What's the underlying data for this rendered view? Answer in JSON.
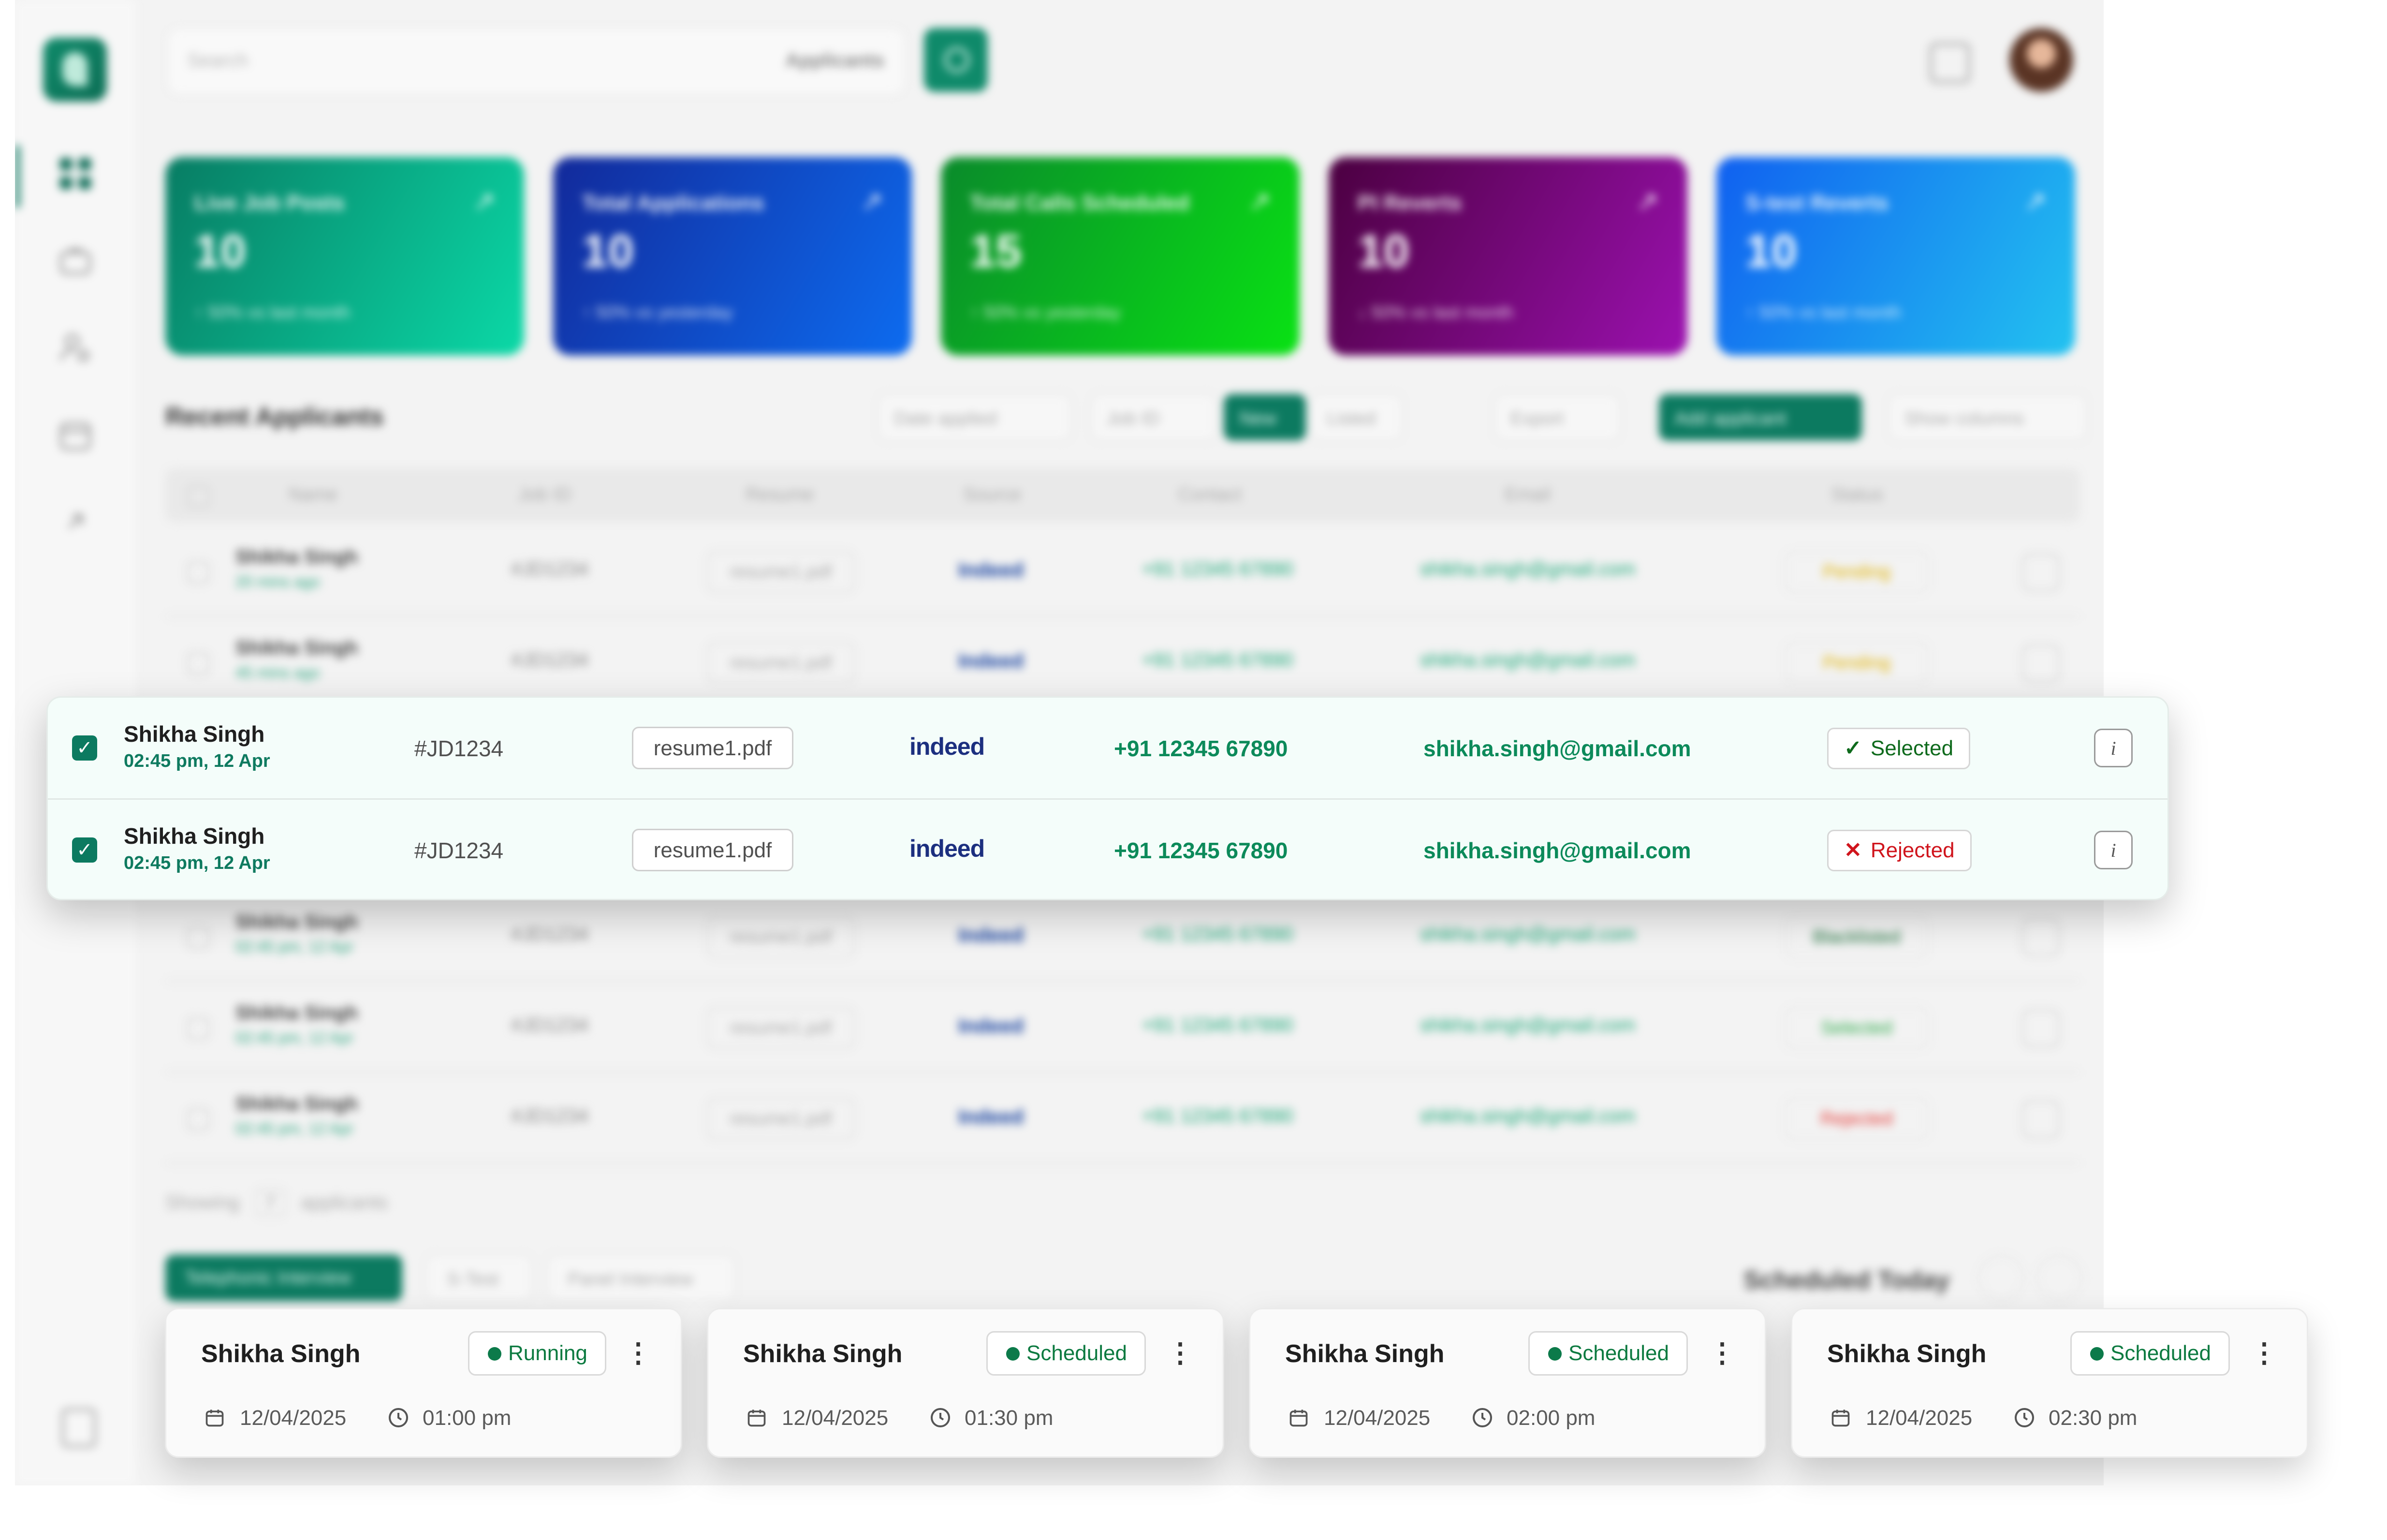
{
  "search": {
    "placeholder": "Search",
    "filter_label": "Applicants"
  },
  "stats": [
    {
      "label": "Live Job Posts",
      "value": "10",
      "trend": "↑ 50% vs last month"
    },
    {
      "label": "Total Applications",
      "value": "10",
      "trend": "↑ 50% vs yesterday"
    },
    {
      "label": "Total Calls Scheduled",
      "value": "15",
      "trend": "↑ 50% vs yesterday"
    },
    {
      "label": "PI Reverts",
      "value": "10",
      "trend": "↓ 50% vs last month"
    },
    {
      "label": "S-test Reverts",
      "value": "10",
      "trend": "↑ 50% vs last month"
    }
  ],
  "applicants": {
    "title": "Recent Applicants",
    "toolbar": {
      "date_applied": "Date applied",
      "job_id": "Job ID",
      "filter_active": "New",
      "filter_other": "Listed",
      "export": "Export",
      "add": "Add applicant",
      "columns": "Show columns"
    },
    "columns": [
      "Name",
      "Job ID",
      "Resume",
      "Source",
      "Contact",
      "Email",
      "Status"
    ],
    "bg_rows": [
      {
        "name": "Shikha Singh",
        "time": "20 mins ago",
        "job": "#JD1234",
        "resume": "resume1.pdf",
        "source": "Indeed",
        "phone": "+91 12345 67890",
        "email": "shikha.singh@gmail.com",
        "status": "Pending"
      },
      {
        "name": "Shikha Singh",
        "time": "45 mins ago",
        "job": "#JD1234",
        "resume": "resume1.pdf",
        "source": "Indeed",
        "phone": "+91 12345 67890",
        "email": "shikha.singh@gmail.com",
        "status": "Pending"
      },
      {
        "name": "Shikha Singh",
        "time": "02:45 pm, 12 Apr",
        "job": "#JD1234",
        "resume": "resume1.pdf",
        "source": "Indeed",
        "phone": "+91 12345 67890",
        "email": "shikha.singh@gmail.com",
        "status": "Blacklisted"
      },
      {
        "name": "Shikha Singh",
        "time": "02:45 pm, 12 Apr",
        "job": "#JD1234",
        "resume": "resume1.pdf",
        "source": "Indeed",
        "phone": "+91 12345 67890",
        "email": "shikha.singh@gmail.com",
        "status": "Selected"
      },
      {
        "name": "Shikha Singh",
        "time": "02:45 pm, 12 Apr",
        "job": "#JD1234",
        "resume": "resume1.pdf",
        "source": "Indeed",
        "phone": "+91 12345 67890",
        "email": "shikha.singh@gmail.com",
        "status": "Rejected"
      }
    ],
    "selected_rows": [
      {
        "name": "Shikha Singh",
        "time": "02:45 pm, 12 Apr",
        "job": "#JD1234",
        "resume": "resume1.pdf",
        "source": "indeed",
        "phone": "+91 12345 67890",
        "email": "shikha.singh@gmail.com",
        "status": "Selected",
        "status_icon": "check-icon",
        "info": "i"
      },
      {
        "name": "Shikha Singh",
        "time": "02:45 pm, 12 Apr",
        "job": "#JD1234",
        "resume": "resume1.pdf",
        "source": "indeed",
        "phone": "+91 12345 67890",
        "email": "shikha.singh@gmail.com",
        "status": "Rejected",
        "status_icon": "x-icon",
        "info": "i"
      }
    ],
    "showing_label": "Showing",
    "showing_count": "7",
    "showing_suffix": "applicants"
  },
  "interviews": {
    "tabs": [
      "Telephonic Interview",
      "S-Test",
      "Panel Interview"
    ],
    "scheduled_title": "Scheduled Today",
    "cards": [
      {
        "name": "Shikha Singh",
        "status": "Running",
        "date": "12/04/2025",
        "time": "01:00 pm"
      },
      {
        "name": "Shikha Singh",
        "status": "Scheduled",
        "date": "12/04/2025",
        "time": "01:30 pm"
      },
      {
        "name": "Shikha Singh",
        "status": "Scheduled",
        "date": "12/04/2025",
        "time": "02:00 pm"
      },
      {
        "name": "Shikha Singh",
        "status": "Scheduled",
        "date": "12/04/2025",
        "time": "02:30 pm"
      }
    ]
  },
  "colors": {
    "brand": "#0c7a60",
    "selected": "#0e6a1c",
    "rejected": "#d0141c",
    "link": "#0c8a5a"
  }
}
